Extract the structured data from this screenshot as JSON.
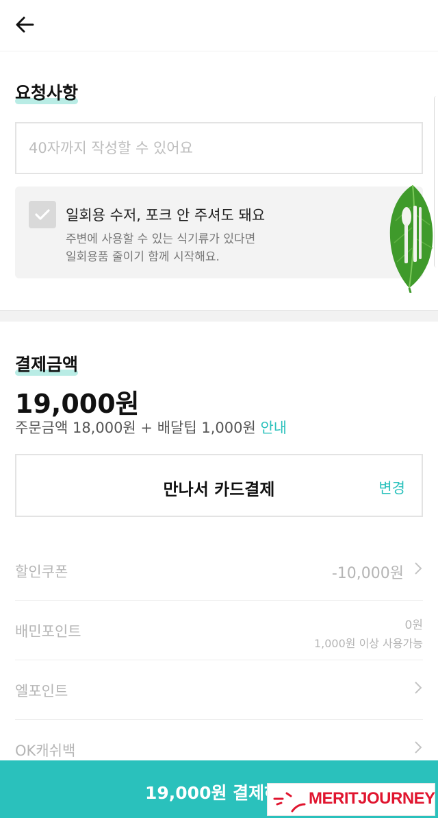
{
  "request": {
    "title": "요청사항",
    "placeholder": "40자까지 작성할 수 있어요",
    "eco_title": "일회용 수저, 포크 안 주셔도 돼요",
    "eco_desc": "주변에 사용할 수 있는 식기류가 있다면\n일회용품 줄이기 함께 시작해요."
  },
  "payment": {
    "title": "결제금액",
    "total": "19,000원",
    "breakdown": "주문금액 18,000원 + 배달팁 1,000원",
    "breakdown_link": "안내",
    "method": "만나서 카드결제",
    "change": "변경"
  },
  "discounts": {
    "coupon_label": "할인쿠폰",
    "coupon_value": "-10,000원",
    "points_label": "배민포인트",
    "points_value": "0원",
    "points_note": "1,000원 이상 사용가능",
    "lpoint_label": "엘포인트",
    "okcash_label": "OK캐쉬백"
  },
  "footer": {
    "pay_button": "19,000원 결제하기",
    "watermark": "MERITJOURNEY"
  },
  "colors": {
    "accent": "#2ac1bc",
    "highlight": "#b9ece5",
    "watermark": "#e0152f"
  },
  "icons": [
    "back-arrow-icon",
    "checkbox-check-icon",
    "chevron-right-icon",
    "leaf-utensils-image"
  ]
}
